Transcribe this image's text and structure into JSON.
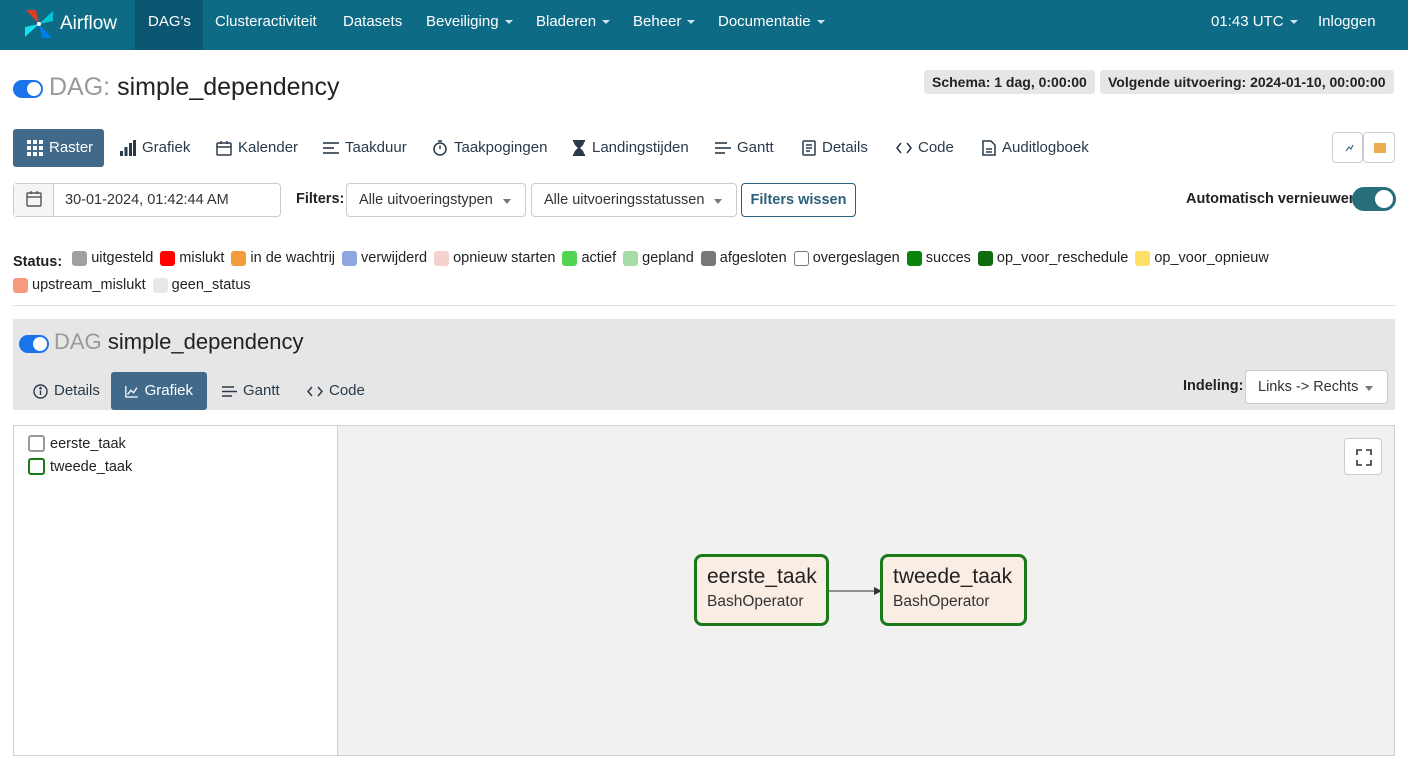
{
  "navbar": {
    "brand": "Airflow",
    "items": [
      {
        "label": "DAG's",
        "active": true
      },
      {
        "label": "Clusteractiviteit"
      },
      {
        "label": "Datasets"
      },
      {
        "label": "Beveiliging"
      },
      {
        "label": "Bladeren"
      },
      {
        "label": "Beheer"
      },
      {
        "label": "Documentatie"
      }
    ],
    "time": "01:43 UTC",
    "login": "Inloggen"
  },
  "header": {
    "dag_prefix": "DAG:",
    "dag_id": "simple_dependency",
    "schedule": "Schema: 1 dag, 0:00:00",
    "next_run": "Volgende uitvoering: 2024-01-10, 00:00:00"
  },
  "tabs": [
    "Raster",
    "Grafiek",
    "Kalender",
    "Taakduur",
    "Taakpogingen",
    "Landingstijden",
    "Gantt",
    "Details",
    "Code",
    "Auditlogboek"
  ],
  "filters": {
    "date_value": "30-01-2024, 01:42:44 AM",
    "label": "Filters:",
    "run_type": "Alle uitvoeringstypen",
    "run_state": "Alle uitvoeringsstatussen",
    "clear_button": "Filters wissen",
    "auto_refresh_label": "Automatisch vernieuwen"
  },
  "legend": {
    "label": "Status:",
    "items": [
      {
        "label": "uitgesteld",
        "color": "#a0a0a0"
      },
      {
        "label": "mislukt",
        "color": "#ff0000"
      },
      {
        "label": "in de wachtrij",
        "color": "#f39c3c"
      },
      {
        "label": "verwijderd",
        "color": "#8fa6e0"
      },
      {
        "label": "opnieuw starten",
        "color": "#f7d0d0"
      },
      {
        "label": "actief",
        "color": "#52d452"
      },
      {
        "label": "gepland",
        "color": "#a6dca6"
      },
      {
        "label": "afgesloten",
        "color": "#777777"
      },
      {
        "label": "overgeslagen",
        "color": "#ffffff"
      },
      {
        "label": "succes",
        "color": "#0a840a"
      },
      {
        "label": "op_voor_reschedule",
        "color": "#0e6b0e"
      },
      {
        "label": "op_voor_opnieuw",
        "color": "#ffe066"
      },
      {
        "label": "upstream_mislukt",
        "color": "#f79a80"
      },
      {
        "label": "geen_status",
        "color": "#e8e8e8"
      }
    ]
  },
  "panel": {
    "dag_prefix": "DAG",
    "dag_id": "simple_dependency",
    "subtabs": [
      "Details",
      "Grafiek",
      "Gantt",
      "Code"
    ],
    "layout_label": "Indeling:",
    "layout_value": "Links -> Rechts"
  },
  "tree": [
    {
      "label": "eerste_taak",
      "border": "#999999"
    },
    {
      "label": "tweede_taak",
      "border": "#1a7a1a"
    }
  ],
  "nodes": [
    {
      "name": "eerste_taak",
      "operator": "BashOperator"
    },
    {
      "name": "tweede_taak",
      "operator": "BashOperator"
    }
  ]
}
